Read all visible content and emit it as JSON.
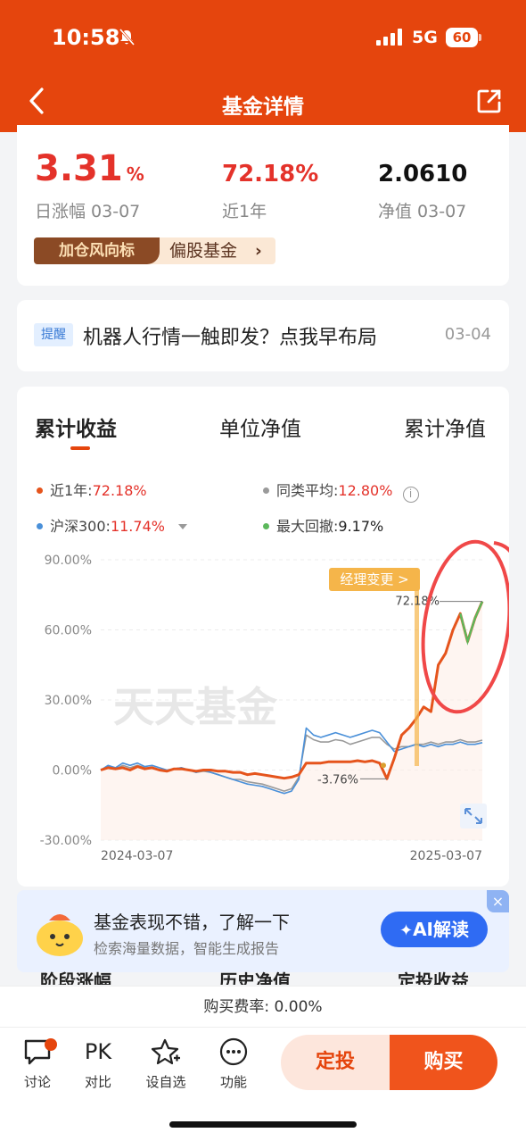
{
  "status_bar": {
    "time": "10:58",
    "network": "5G",
    "battery": "60"
  },
  "nav": {
    "title": "基金详情"
  },
  "summary": {
    "daily_change": "3.31",
    "daily_change_unit": "%",
    "daily_change_label": "日涨幅 03-07",
    "one_year": "72.18%",
    "one_year_label": "近1年",
    "nav_value": "2.0610",
    "nav_label": "净值 03-07",
    "tag_badge": "加仓风向标",
    "tag_category": "偏股基金"
  },
  "notice": {
    "badge": "提醒",
    "text": "机器人行情一触即发？点我早布局",
    "date": "03-04"
  },
  "chart_tabs": [
    "累计收益",
    "单位净值",
    "累计净值"
  ],
  "legend": {
    "fund_label": "近1年:",
    "fund_value": "72.18%",
    "peer_label": "同类平均:",
    "peer_value": "12.80%",
    "index_label": "沪深300:",
    "index_value": "11.74%",
    "drawdown_label": "最大回撤:",
    "drawdown_value": "9.17%"
  },
  "chart_data": {
    "type": "line",
    "x_start": "2024-03-07",
    "x_end": "2025-03-07",
    "ylim": [
      -30,
      90
    ],
    "yticks": [
      "90.00%",
      "60.00%",
      "30.00%",
      "0.00%",
      "-30.00%"
    ],
    "watermark": "天天基金",
    "event_label": "经理变更 >",
    "annotations": {
      "max": "72.18%",
      "min": "-3.76%"
    },
    "colors": {
      "fund": "#e5541c",
      "peer": "#9a9a9a",
      "index": "#4a90d9",
      "drawdown": "#5cb85c"
    },
    "series": [
      {
        "name": "近1年",
        "values": [
          0,
          1,
          0.5,
          1,
          0,
          1.5,
          0.5,
          1,
          0,
          -0.5,
          0.5,
          0.5,
          0,
          -0.5,
          0,
          0,
          -0.5,
          -0.5,
          -1,
          -1,
          -2,
          -1.5,
          -2,
          -2.5,
          -3,
          -3.5,
          -3,
          -2,
          3,
          3,
          3,
          3.5,
          3.5,
          3.5,
          3.5,
          4,
          3.5,
          4,
          3,
          -3.76,
          5,
          15,
          18,
          22,
          27,
          25,
          45,
          50,
          60,
          67,
          55,
          65,
          72.18
        ]
      },
      {
        "name": "同类平均",
        "values": [
          0,
          1.5,
          0.5,
          2,
          1,
          2,
          1,
          1,
          0,
          -0.5,
          0.5,
          1,
          0,
          -1,
          -0.5,
          -1,
          -2,
          -3,
          -4,
          -4,
          -5,
          -5.5,
          -6,
          -7,
          -8,
          -9,
          -8,
          -3,
          15,
          13,
          12,
          12,
          13,
          12.5,
          11,
          12,
          13,
          14,
          14,
          11,
          9,
          10,
          10,
          11,
          11,
          12,
          11,
          12,
          12,
          13,
          12,
          12,
          12.8
        ]
      },
      {
        "name": "沪深300",
        "values": [
          0,
          2,
          1,
          3,
          2,
          3,
          1.5,
          2,
          1,
          0,
          0.5,
          1,
          0,
          -1,
          0,
          -1,
          -2,
          -3,
          -4,
          -5,
          -6,
          -6.5,
          -7,
          -8,
          -9,
          -10,
          -9,
          -4,
          18,
          15,
          14,
          15,
          16,
          15,
          14,
          15,
          16,
          17,
          16,
          12,
          8,
          9,
          10,
          11,
          10,
          11,
          10,
          11,
          11,
          12,
          11,
          11,
          11.74
        ]
      }
    ]
  },
  "ai_banner": {
    "title": "基金表现不错，了解一下",
    "subtitle": "检索海量数据，智能生成报告",
    "button": "AI解读",
    "close": "×"
  },
  "section_tabs": [
    "阶段涨幅",
    "历史净值",
    "定投收益"
  ],
  "fee": {
    "text": "购买费率: 0.00%"
  },
  "bottom_bar": {
    "discuss": "讨论",
    "compare_icon_text": "PK",
    "compare": "对比",
    "watchlist": "设自选",
    "more": "功能",
    "invest_button": "定投",
    "buy_button": "购买"
  }
}
